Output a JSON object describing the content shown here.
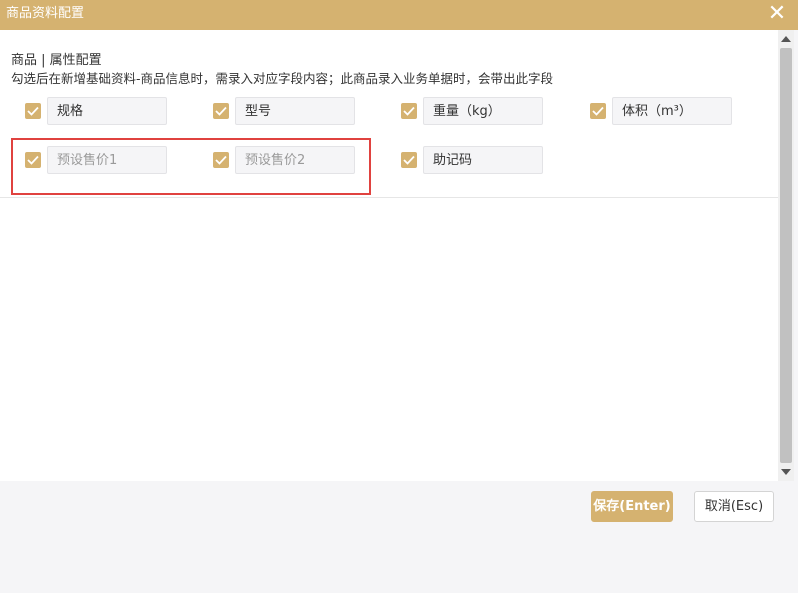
{
  "dialog": {
    "title": "商品资料配置",
    "close_icon": "close-icon"
  },
  "section": {
    "title": "商品 | 属性配置",
    "description": "勾选后在新增基础资料-商品信息时，需录入对应字段内容；此商品录入业务单据时，会带出此字段"
  },
  "fields": [
    {
      "label": "规格",
      "checked": true
    },
    {
      "label": "型号",
      "checked": true
    },
    {
      "label": "重量（kg）",
      "checked": true
    },
    {
      "label": "体积（m³）",
      "checked": true
    },
    {
      "label": "预设售价1",
      "checked": true
    },
    {
      "label": "预设售价2",
      "checked": true
    },
    {
      "label": "助记码",
      "checked": true
    }
  ],
  "buttons": {
    "save": "保存(Enter)",
    "cancel": "取消(Esc)"
  },
  "colors": {
    "accent": "#d5b270",
    "highlight_border": "#e0423f"
  }
}
